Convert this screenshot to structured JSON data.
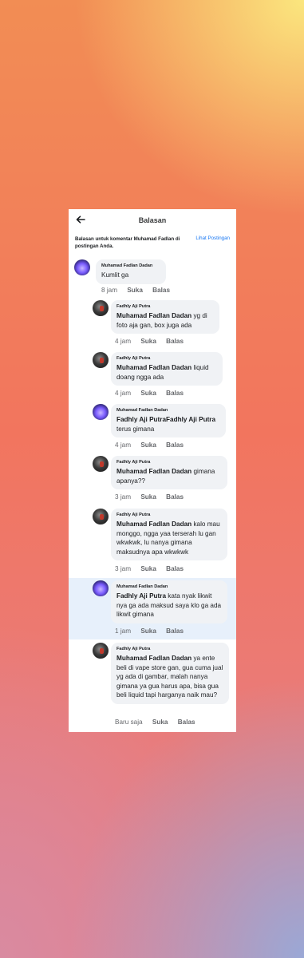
{
  "header": {
    "title": "Balasan"
  },
  "info": {
    "text": "Balasan untuk komentar Muhamad Fadlan di postingan Anda.",
    "link": "Lihat Postingan"
  },
  "actions": {
    "like": "Suka",
    "reply": "Balas"
  },
  "comments": [
    {
      "author": "Muhamad Fadlan Dadan",
      "mention": "",
      "text": "Kumlit ga",
      "time": "8 jam"
    },
    {
      "author": "Fadhly Aji Putra",
      "mention": "Muhamad Fadlan Dadan",
      "text": " yg di foto aja gan, box juga ada",
      "time": "4 jam"
    },
    {
      "author": "Fadhly Aji Putra",
      "mention": "Muhamad Fadlan Dadan",
      "text": " liquid doang ngga ada",
      "time": "4 jam"
    },
    {
      "author": "Muhamad Fadlan Dadan",
      "mention": "Fadhly Aji PutraFadhly Aji Putra",
      "text": " terus gimana",
      "time": "4 jam"
    },
    {
      "author": "Fadhly Aji Putra",
      "mention": "Muhamad Fadlan Dadan",
      "text": " gimana apanya??",
      "time": "3 jam"
    },
    {
      "author": "Fadhly Aji Putra",
      "mention": "Muhamad Fadlan Dadan",
      "text": " kalo mau monggo, ngga yaa terserah lu gan wkwkwk, lu nanya gimana maksudnya apa wkwkwk",
      "time": "3 jam"
    },
    {
      "author": "Muhamad Fadlan Dadan",
      "mention": "Fadhly Aji Putra",
      "text": " kata nyak likwit nya ga ada maksud saya klo ga ada likwit gimana",
      "time": "1 jam"
    },
    {
      "author": "Fadhly Aji Putra",
      "mention": "Muhamad Fadlan Dadan",
      "text": " ya ente beli di vape store gan, gua cuma jual yg ada di gambar, malah nanya gimana ya gua harus apa, bisa gua beli liquid tapi harganya naik mau?",
      "time": "Baru saja"
    }
  ]
}
